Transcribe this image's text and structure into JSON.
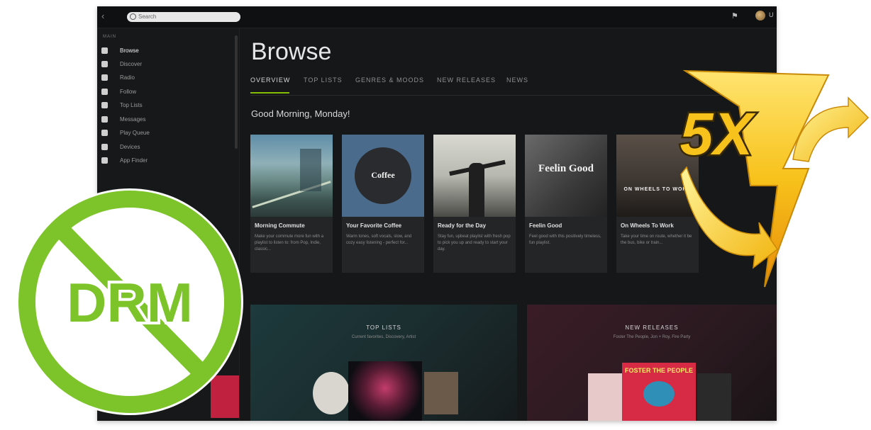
{
  "window": {
    "search_placeholder": "Search",
    "back_glyph": "‹",
    "user_name": "U",
    "icons": [
      "search-icon",
      "bell-icon",
      "avatar"
    ]
  },
  "sidebar": {
    "heading": "MAIN",
    "items": [
      {
        "label": "Browse",
        "icon": "browse-icon",
        "active": true
      },
      {
        "label": "Discover",
        "icon": "discover-icon"
      },
      {
        "label": "Radio",
        "icon": "radio-icon"
      },
      {
        "label": "Follow",
        "icon": "follow-icon"
      },
      {
        "label": "Top Lists",
        "icon": "toplists-icon"
      },
      {
        "label": "Messages",
        "icon": "messages-icon"
      },
      {
        "label": "Play Queue",
        "icon": "queue-icon"
      },
      {
        "label": "Devices",
        "icon": "devices-icon"
      },
      {
        "label": "App Finder",
        "icon": "appfinder-icon"
      }
    ]
  },
  "main": {
    "title": "Browse",
    "tabs": [
      "OVERVIEW",
      "TOP LISTS",
      "GENRES & MOODS",
      "NEW RELEASES",
      "NEWS"
    ],
    "greeting": "Good Morning, Monday!",
    "cards": [
      {
        "title": "Morning Commute",
        "desc": "Make your commute more fun with a playlist to listen to: from Pop, Indie, classic..."
      },
      {
        "title": "Your Favorite Coffee",
        "desc": "Warm tones, soft vocals, slow, and cozy easy listening - perfect for..."
      },
      {
        "title": "Ready for the Day",
        "desc": "Stay fun, upbeat playlist with fresh pop to pick you up and ready to start your day."
      },
      {
        "title": "Feelin Good",
        "desc": "Feel good with this positively timeless, fun playlist."
      },
      {
        "title": "On Wheels To Work",
        "desc": "Take your time on route, whether it be the bus, bike or train..."
      }
    ],
    "card_art_text": {
      "coffee": "Coffee",
      "feelin": "Feelin Good",
      "wheels": "ON WHEELS TO WORK"
    },
    "shelves": [
      {
        "title": "TOP LISTS",
        "subtitle": "Current favorites, Discovery, Artist"
      },
      {
        "title": "NEW RELEASES",
        "subtitle": "Foster The People, Jon + Roy, Fire Party"
      }
    ],
    "album_text": "FOSTER THE PEOPLE"
  },
  "badges": {
    "drm_label": "DRM",
    "speed_label": "5X"
  },
  "colors": {
    "accent": "#84bd00",
    "drm_green": "#7dc42a",
    "bolt_yellow": "#f7c21b",
    "window_bg": "#121314"
  }
}
